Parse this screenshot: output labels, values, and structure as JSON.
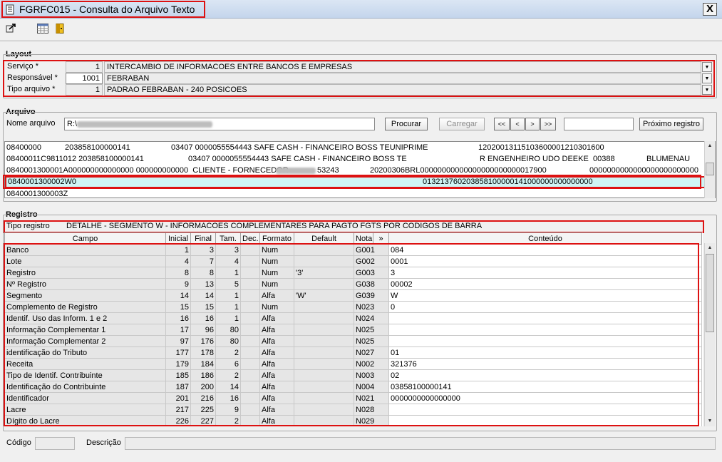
{
  "window": {
    "title": "FGRFC015 - Consulta do Arquivo Texto",
    "close_label": "X"
  },
  "toolbar": {
    "icons": [
      "exit-arrow-icon",
      "table-grid-icon",
      "door-exit-icon"
    ]
  },
  "layout": {
    "section_label": "Layout",
    "fields": [
      {
        "label": "Serviço *",
        "code": "1",
        "description": "INTERCAMBIO DE INFORMACOES ENTRE BANCOS E EMPRESAS"
      },
      {
        "label": "Responsável *",
        "code": "1001",
        "description": "FEBRABAN"
      },
      {
        "label": "Tipo arquivo *",
        "code": "1",
        "description": "PADRAO FEBRABAN - 240 POSICOES"
      }
    ]
  },
  "arquivo": {
    "section_label": "Arquivo",
    "nome_label": "Nome arquivo",
    "nome_value": "R:\\",
    "procurar_label": "Procurar",
    "carregar_label": "Carregar",
    "nav_first": "<<",
    "nav_prev": "<",
    "nav_next": ">",
    "nav_last": ">>",
    "search_value": "",
    "proximo_label": "Próximo registro",
    "lines": [
      {
        "cols": [
          "08400000",
          "203858100000141",
          "03407 0000055554443 SAFE CASH - FINANCEIRO BOSS TEUNIPRIME",
          "12020013115103600001210301600",
          "",
          ""
        ]
      },
      {
        "cols": [
          "08400011C9811012 203858100000141",
          "",
          "03407 0000055554443 SAFE CASH - FINANCEIRO BOSS TE",
          "R ENGENHEIRO UDO DEEKE",
          "00388",
          "BLUMENAU"
        ]
      },
      {
        "cols": [
          "0840001300001A000000000000000 000000000000  CLIENTE - FORNECEDOR",
          "",
          "53243",
          "20200306BRL00000000000000000000000017900",
          "0000000000000000000000000",
          ""
        ]
      },
      {
        "cols": [
          "0840001300002W0",
          "",
          "",
          "013213760203858100000141000000000000000",
          "",
          ""
        ]
      },
      {
        "cols": [
          "0840001300003Z",
          "",
          "",
          "",
          "",
          ""
        ]
      }
    ]
  },
  "registro": {
    "section_label": "Registro",
    "tipo_label": "Tipo registro",
    "tipo_value": "DETALHE - SEGMENTO W - INFORMACOES COMPLEMENTARES PARA PAGTO FGTS POR CODIGOS DE BARRA",
    "columns": [
      "Campo",
      "Inicial",
      "Final",
      "Tam.",
      "Dec.",
      "Formato",
      "Default",
      "Nota",
      "»",
      "Conteúdo"
    ],
    "rows": [
      {
        "campo": "Banco",
        "inicial": "1",
        "final": "3",
        "tam": "3",
        "dec": "",
        "formato": "Num",
        "default": "",
        "nota": "G001",
        "conteudo": "084"
      },
      {
        "campo": "Lote",
        "inicial": "4",
        "final": "7",
        "tam": "4",
        "dec": "",
        "formato": "Num",
        "default": "",
        "nota": "G002",
        "conteudo": "0001"
      },
      {
        "campo": "Registro",
        "inicial": "8",
        "final": "8",
        "tam": "1",
        "dec": "",
        "formato": "Num",
        "default": "'3'",
        "nota": "G003",
        "conteudo": "3"
      },
      {
        "campo": "Nº Registro",
        "inicial": "9",
        "final": "13",
        "tam": "5",
        "dec": "",
        "formato": "Num",
        "default": "",
        "nota": "G038",
        "conteudo": "00002"
      },
      {
        "campo": "Segmento",
        "inicial": "14",
        "final": "14",
        "tam": "1",
        "dec": "",
        "formato": "Alfa",
        "default": "'W'",
        "nota": "G039",
        "conteudo": "W"
      },
      {
        "campo": "Complemento de Registro",
        "inicial": "15",
        "final": "15",
        "tam": "1",
        "dec": "",
        "formato": "Num",
        "default": "",
        "nota": "N023",
        "conteudo": "0"
      },
      {
        "campo": "Identif. Uso das Inform. 1 e 2",
        "inicial": "16",
        "final": "16",
        "tam": "1",
        "dec": "",
        "formato": "Alfa",
        "default": "",
        "nota": "N024",
        "conteudo": ""
      },
      {
        "campo": "Informação Complementar 1",
        "inicial": "17",
        "final": "96",
        "tam": "80",
        "dec": "",
        "formato": "Alfa",
        "default": "",
        "nota": "N025",
        "conteudo": ""
      },
      {
        "campo": "Informação Complementar 2",
        "inicial": "97",
        "final": "176",
        "tam": "80",
        "dec": "",
        "formato": "Alfa",
        "default": "",
        "nota": "N025",
        "conteudo": ""
      },
      {
        "campo": "identificação do Tributo",
        "inicial": "177",
        "final": "178",
        "tam": "2",
        "dec": "",
        "formato": "Alfa",
        "default": "",
        "nota": "N027",
        "conteudo": "01"
      },
      {
        "campo": "Receita",
        "inicial": "179",
        "final": "184",
        "tam": "6",
        "dec": "",
        "formato": "Alfa",
        "default": "",
        "nota": "N002",
        "conteudo": "321376"
      },
      {
        "campo": "Tipo de Identif. Contribuinte",
        "inicial": "185",
        "final": "186",
        "tam": "2",
        "dec": "",
        "formato": "Alfa",
        "default": "",
        "nota": "N003",
        "conteudo": "02"
      },
      {
        "campo": "Identificação do Contribuinte",
        "inicial": "187",
        "final": "200",
        "tam": "14",
        "dec": "",
        "formato": "Alfa",
        "default": "",
        "nota": "N004",
        "conteudo": "03858100000141"
      },
      {
        "campo": "Identificador",
        "inicial": "201",
        "final": "216",
        "tam": "16",
        "dec": "",
        "formato": "Alfa",
        "default": "",
        "nota": "N021",
        "conteudo": "0000000000000000"
      },
      {
        "campo": "Lacre",
        "inicial": "217",
        "final": "225",
        "tam": "9",
        "dec": "",
        "formato": "Alfa",
        "default": "",
        "nota": "N028",
        "conteudo": ""
      },
      {
        "campo": "Dígito do Lacre",
        "inicial": "226",
        "final": "227",
        "tam": "2",
        "dec": "",
        "formato": "Alfa",
        "default": "",
        "nota": "N029",
        "conteudo": ""
      }
    ]
  },
  "footer": {
    "codigo_label": "Código",
    "codigo_value": "",
    "descricao_label": "Descrição",
    "descricao_value": ""
  },
  "colors": {
    "highlight_outline": "#d11111",
    "selected_row": "#cff4f4"
  }
}
